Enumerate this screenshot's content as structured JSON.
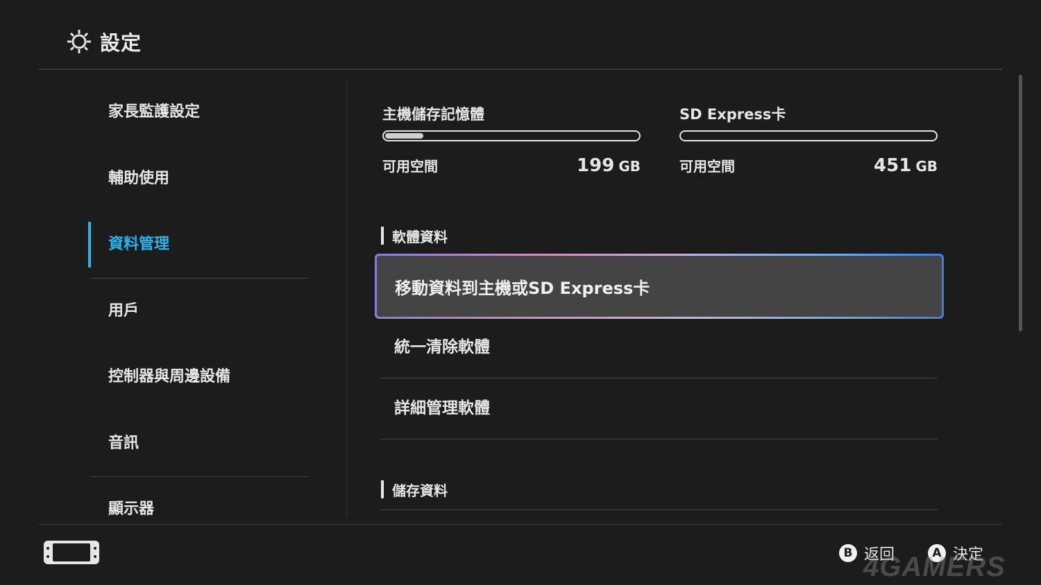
{
  "header": {
    "title": "設定",
    "icon": "gear-icon"
  },
  "sidebar": {
    "items": [
      {
        "label": "家長監護設定"
      },
      {
        "label": "輔助使用"
      },
      {
        "label": "資料管理",
        "active": true
      },
      {
        "label": "用戶"
      },
      {
        "label": "控制器與周邊設備"
      },
      {
        "label": "音訊"
      },
      {
        "label": "顯示器"
      }
    ],
    "active_color": "#2bb4ec"
  },
  "storage": {
    "system": {
      "title": "主機儲存記憶體",
      "free_label": "可用空間",
      "free_value": "199",
      "unit": "GB",
      "used_fraction": 0.15
    },
    "sd": {
      "title": "SD Express卡",
      "free_label": "可用空間",
      "free_value": "451",
      "unit": "GB",
      "used_fraction": 0.0
    }
  },
  "sections": {
    "software": {
      "heading": "軟體資料",
      "items": [
        {
          "label": "移動資料到主機或SD Express卡",
          "selected": true
        },
        {
          "label": "統一清除軟體"
        },
        {
          "label": "詳細管理軟體"
        }
      ]
    },
    "save": {
      "heading": "儲存資料"
    }
  },
  "footer": {
    "back": {
      "button": "B",
      "label": "返回"
    },
    "ok": {
      "button": "A",
      "label": "決定"
    },
    "console_icon": "handheld-console-icon"
  },
  "watermark": "4GAMERS"
}
